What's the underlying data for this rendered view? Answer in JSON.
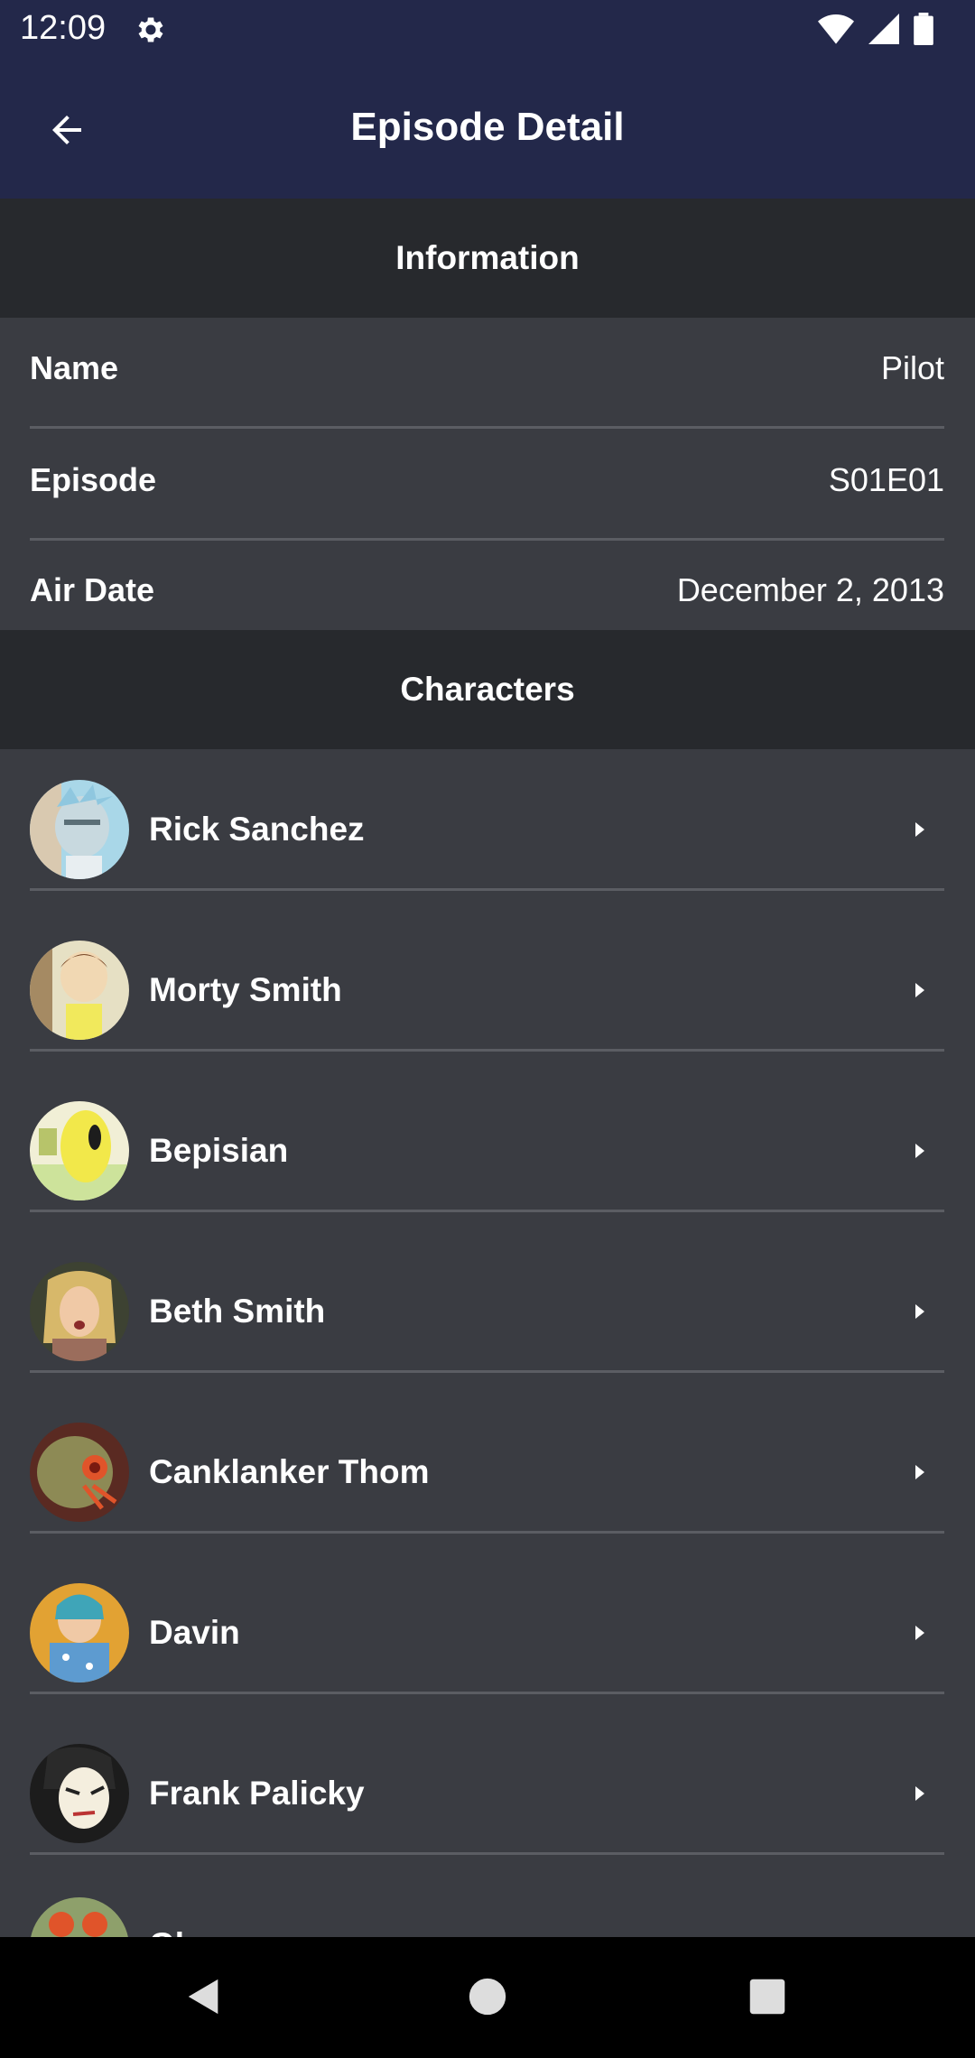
{
  "status_bar": {
    "time": "12:09"
  },
  "app_bar": {
    "title": "Episode Detail"
  },
  "information": {
    "header": "Information",
    "rows": [
      {
        "label": "Name",
        "value": "Pilot"
      },
      {
        "label": "Episode",
        "value": "S01E01"
      },
      {
        "label": "Air Date",
        "value": "December 2, 2013"
      }
    ]
  },
  "characters": {
    "header": "Characters",
    "items": [
      {
        "name": "Rick Sanchez"
      },
      {
        "name": "Morty Smith"
      },
      {
        "name": "Bepisian"
      },
      {
        "name": "Beth Smith"
      },
      {
        "name": "Canklanker Thom"
      },
      {
        "name": "Davin"
      },
      {
        "name": "Frank Palicky"
      },
      {
        "name": "Gl..."
      }
    ]
  },
  "icons": {
    "back": "arrow-back-icon",
    "settings": "gear-icon",
    "wifi": "wifi-icon",
    "signal": "signal-icon",
    "battery": "battery-icon",
    "chevron": "chevron-right-icon",
    "nav_back": "nav-back-icon",
    "nav_home": "nav-home-icon",
    "nav_recents": "nav-recents-icon"
  },
  "colors": {
    "app_bar": "#23284a",
    "section_header": "#27292d",
    "background": "#3a3c42",
    "divider": "#5b5d63"
  }
}
